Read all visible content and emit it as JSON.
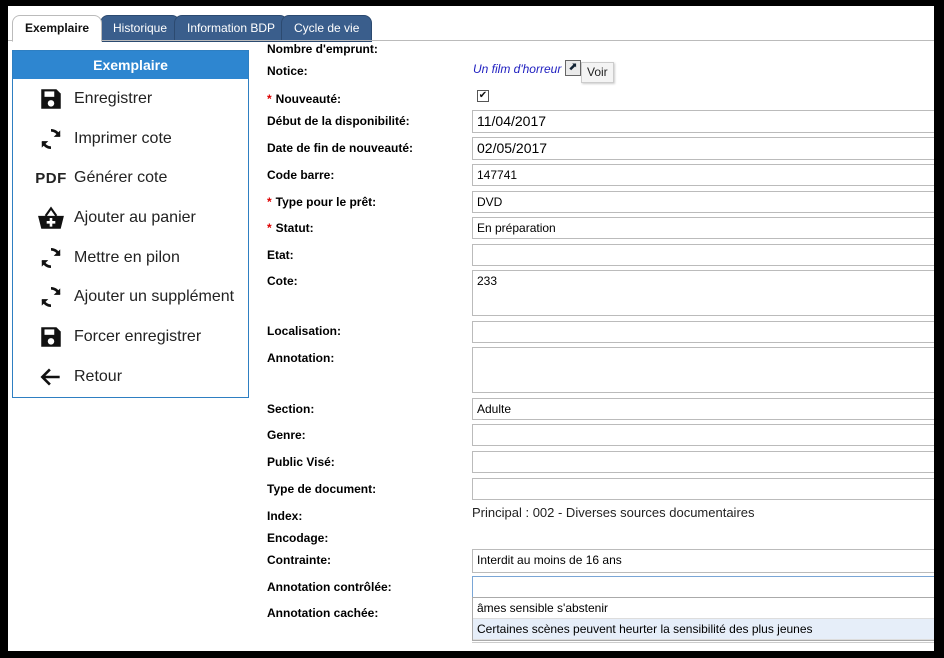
{
  "tabs": [
    {
      "label": "Exemplaire"
    },
    {
      "label": "Historique"
    },
    {
      "label": "Information BDP"
    },
    {
      "label": "Cycle de vie"
    }
  ],
  "sidebar": {
    "title": "Exemplaire",
    "items": [
      {
        "label": "Enregistrer",
        "icon": "save-icon"
      },
      {
        "label": "Imprimer cote",
        "icon": "refresh-icon"
      },
      {
        "label": "Générer cote",
        "icon": "pdf-icon",
        "icon_text": "PDF"
      },
      {
        "label": "Ajouter au panier",
        "icon": "basket-add-icon"
      },
      {
        "label": "Mettre en pilon",
        "icon": "refresh-icon"
      },
      {
        "label": "Ajouter un supplément",
        "icon": "refresh-icon"
      },
      {
        "label": "Forcer enregistrer",
        "icon": "save-icon"
      },
      {
        "label": "Retour",
        "icon": "arrow-left-icon"
      }
    ]
  },
  "form": {
    "nombre_emprunt": {
      "label": "Nombre d'emprunt:"
    },
    "notice": {
      "label": "Notice:",
      "link": "Un film d'horreur",
      "button": "Voir"
    },
    "nouveaute": {
      "label": "Nouveauté:",
      "required": "*",
      "checked": true
    },
    "debut": {
      "label": "Début de la disponibilité:",
      "value": "11/04/2017"
    },
    "fin": {
      "label": "Date de fin de nouveauté:",
      "value": "02/05/2017"
    },
    "code_barre": {
      "label": "Code barre:",
      "value": "147741"
    },
    "type_pret": {
      "label": "Type pour le prêt:",
      "required": "*",
      "value": "DVD"
    },
    "statut": {
      "label": "Statut:",
      "required": "*",
      "value": "En préparation"
    },
    "etat": {
      "label": "Etat:",
      "value": ""
    },
    "cote": {
      "label": "Cote:",
      "value": "233"
    },
    "localisation": {
      "label": "Localisation:",
      "value": ""
    },
    "annotation": {
      "label": "Annotation:",
      "value": ""
    },
    "section": {
      "label": "Section:",
      "value": "Adulte"
    },
    "genre": {
      "label": "Genre:",
      "value": ""
    },
    "public_vise": {
      "label": "Public Visé:",
      "value": ""
    },
    "type_document": {
      "label": "Type de document:",
      "value": ""
    },
    "index": {
      "label": "Index:",
      "value": "Principal : 002 - Diverses sources documentaires"
    },
    "encodage": {
      "label": "Encodage:"
    },
    "contrainte": {
      "label": "Contrainte:",
      "value": "Interdit au moins de 16 ans"
    },
    "annotation_controlee": {
      "label": "Annotation contrôlée:",
      "value": "",
      "options": [
        "âmes sensible s'abstenir",
        "Certaines scènes peuvent heurter la sensibilité des plus jeunes"
      ]
    },
    "annotation_cachee": {
      "label": "Annotation cachée:"
    }
  },
  "colors": {
    "accent": "#2e86d0",
    "tab_inactive": "#3a5e8c",
    "required": "#dd0000",
    "link": "#2020c0"
  }
}
